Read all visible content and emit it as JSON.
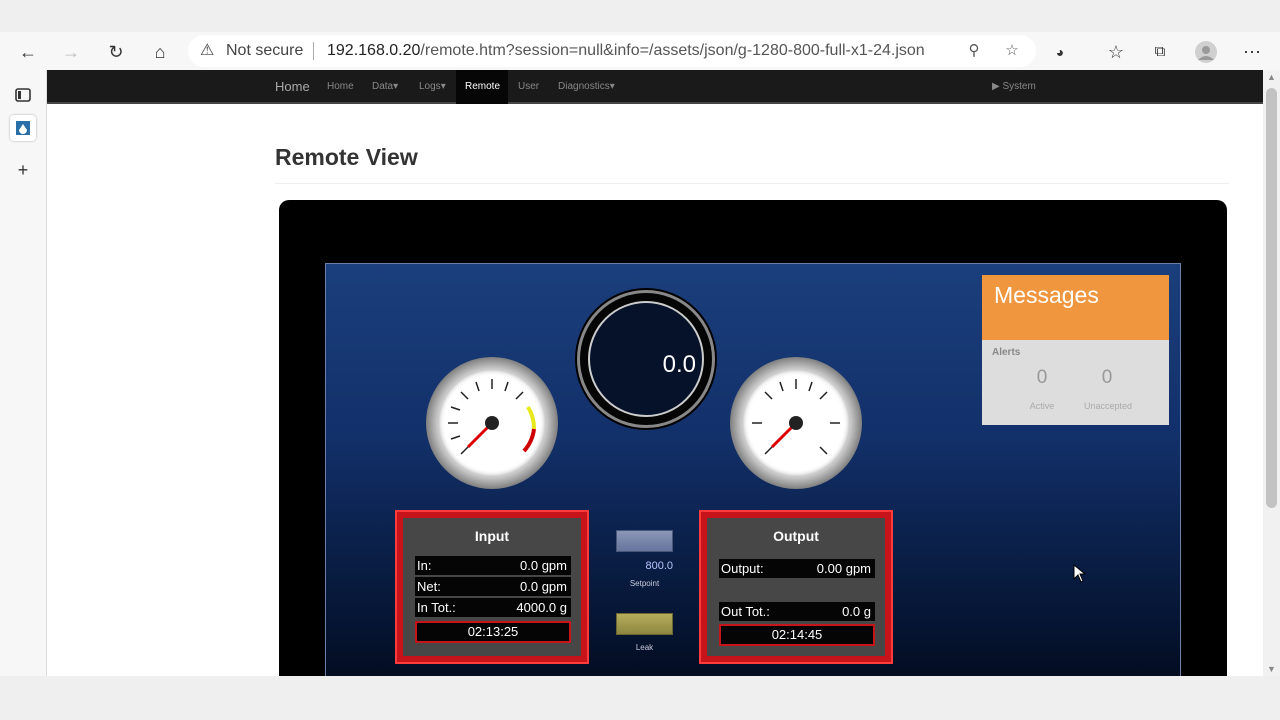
{
  "browser": {
    "security_label": "Not secure",
    "url_host": "192.168.0.20",
    "url_rest": "/remote.htm?session=null&info=/assets/json/g-1280-800-full-x1-24.json"
  },
  "nav": {
    "brand": "Home",
    "items": [
      "Home",
      "Data",
      "Logs",
      "Remote",
      "User",
      "Diagnostics"
    ],
    "system": "System"
  },
  "page": {
    "title": "Remote View"
  },
  "hmi": {
    "dial_value": "0.0",
    "messages": {
      "title": "Messages",
      "alerts_label": "Alerts",
      "active_count": "0",
      "active_label": "Active",
      "unaccepted_count": "0",
      "unaccepted_label": "Unaccepted"
    },
    "input_panel": {
      "title": "Input",
      "rows": [
        {
          "label": "In:",
          "value": "0.0 gpm"
        },
        {
          "label": "Net:",
          "value": "0.0 gpm"
        },
        {
          "label": "In Tot.:",
          "value": "4000.0 g"
        }
      ],
      "time": "02:13:25"
    },
    "output_panel": {
      "title": "Output",
      "rows": [
        {
          "label": "Output:",
          "value": "0.00 gpm"
        },
        {
          "label": "Out Tot.:",
          "value": "0.0 g"
        }
      ],
      "time": "02:14:45"
    },
    "setpoint": {
      "value": "800.0",
      "label": "Setpoint"
    },
    "leak": {
      "label": "Leak"
    }
  }
}
